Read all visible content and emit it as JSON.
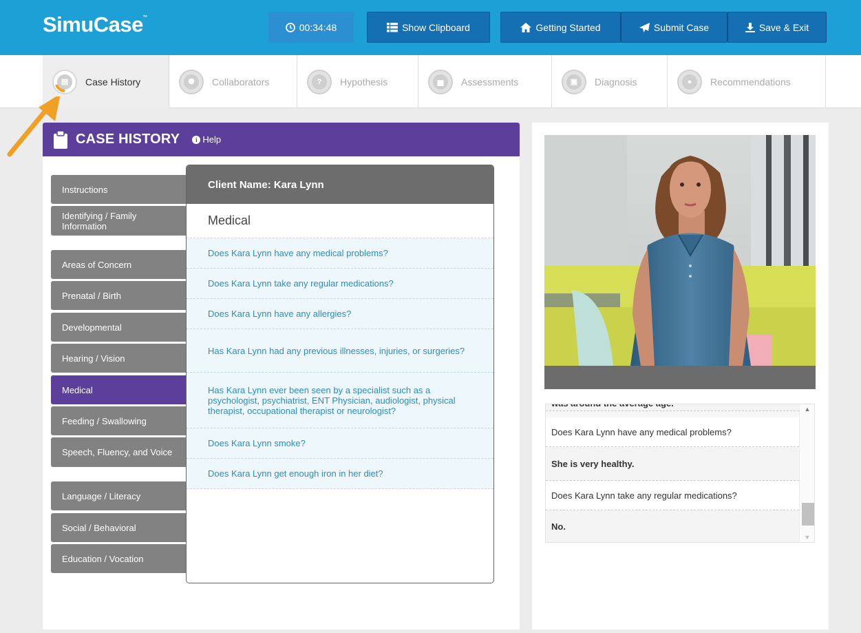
{
  "app": {
    "logo": "SimuCase",
    "logo_tm": "™"
  },
  "topbar": {
    "timer": "00:34:48",
    "show_clipboard": "Show Clipboard",
    "getting_started": "Getting Started",
    "submit_case": "Submit Case",
    "save_exit": "Save & Exit"
  },
  "steps": [
    {
      "label": "Case History",
      "icon": "clipboard-icon"
    },
    {
      "label": "Collaborators",
      "icon": "people-icon"
    },
    {
      "label": "Hypothesis",
      "icon": "question-icon"
    },
    {
      "label": "Assessments",
      "icon": "chart-icon"
    },
    {
      "label": "Diagnosis",
      "icon": "briefcase-icon"
    },
    {
      "label": "Recommendations",
      "icon": "chat-icon"
    }
  ],
  "case_history": {
    "title": "CASE HISTORY",
    "help": "Help",
    "tabs": [
      "Instructions",
      "Identifying / Family Information",
      "Areas of Concern",
      "Prenatal / Birth",
      "Developmental",
      "Hearing / Vision",
      "Medical",
      "Feeding / Swallowing",
      "Speech, Fluency, and Voice",
      "Language / Literacy",
      "Social / Behavioral",
      "Education / Vocation"
    ],
    "active_tab": "Medical",
    "client_label": "Client Name: Kara Lynn",
    "section": "Medical",
    "questions": [
      "Does Kara Lynn have any medical problems?",
      "Does Kara Lynn take any regular medications?",
      "Does Kara Lynn have any allergies?",
      "Has Kara Lynn had any previous illnesses, injuries, or surgeries?",
      "Has Kara Lynn ever been seen by a specialist such as a psychologist, psychiatrist, ENT Physician, audiologist, physical therapist, occupational therapist or neurologist?",
      "Does Kara Lynn smoke?",
      "Does Kara Lynn get enough iron in her diet?"
    ]
  },
  "conversation": {
    "partial": "was around the average age.",
    "items": [
      {
        "type": "question",
        "text": "Does Kara Lynn have any medical problems?"
      },
      {
        "type": "answer",
        "text": "She is very healthy."
      },
      {
        "type": "question",
        "text": "Does Kara Lynn take any regular medications?"
      },
      {
        "type": "answer",
        "text": "No."
      }
    ]
  },
  "colors": {
    "topbar": "#1da0d6",
    "button": "#156fb3",
    "purple": "#5c3f9a",
    "tab_gray": "#828282",
    "question_blue": "#2a8cc4"
  }
}
